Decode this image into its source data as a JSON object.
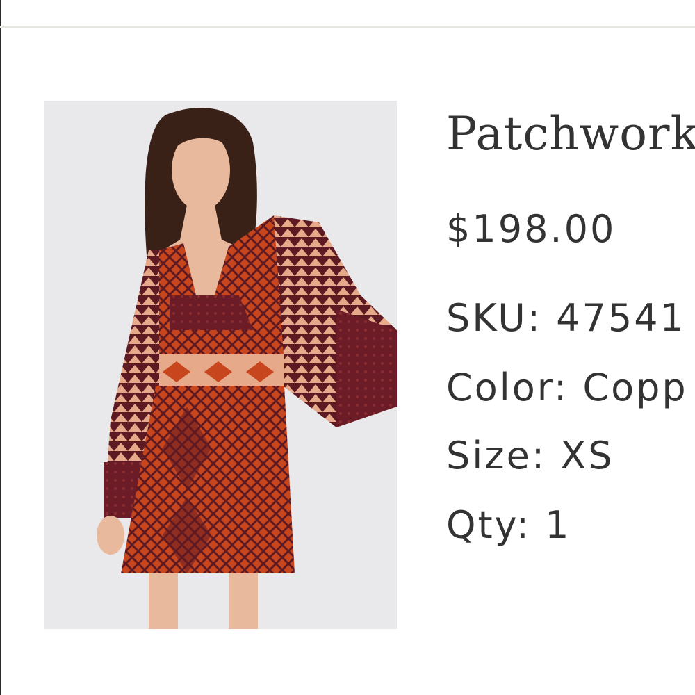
{
  "product": {
    "name": "Patchwork",
    "price": "$198.00",
    "sku_line": "SKU: 47541",
    "color_line": "Color: Copp",
    "size_line": "Size: XS",
    "qty_line": "Qty: 1"
  },
  "image": {
    "icon": "product-photo-dress",
    "colors": {
      "background": "#e9e8ea",
      "dress_orange": "#c8461e",
      "dress_maroon": "#5e1a22",
      "dress_peach": "#e6a98a",
      "hair": "#3a2118",
      "skin": "#e8b99c"
    }
  }
}
